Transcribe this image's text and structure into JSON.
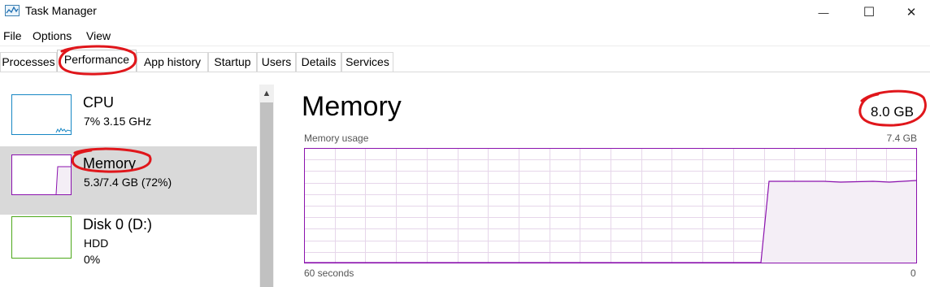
{
  "window": {
    "title": "Task Manager",
    "minimize_glyph": "—",
    "maximize_glyph": "☐",
    "close_glyph": "✕"
  },
  "menu": [
    "File",
    "Options",
    "View"
  ],
  "tabs": [
    "Processes",
    "Performance",
    "App history",
    "Startup",
    "Users",
    "Details",
    "Services"
  ],
  "active_tab": "Performance",
  "sidebar": {
    "items": [
      {
        "name": "CPU",
        "line1": "7%  3.15 GHz",
        "line2": "",
        "color": "#1787c4",
        "selected": false
      },
      {
        "name": "Memory",
        "line1": "5.3/7.4 GB (72%)",
        "line2": "",
        "color": "#8b12ae",
        "selected": true
      },
      {
        "name": "Disk 0 (D:)",
        "line1": "HDD",
        "line2": "0%",
        "color": "#4da81a",
        "selected": false
      }
    ]
  },
  "main": {
    "title": "Memory",
    "total": "8.0 GB",
    "usage_label": "Memory usage",
    "usage_max": "7.4 GB",
    "time_label": "60 seconds",
    "time_zero": "0",
    "accent": "#8b12ae",
    "fill": "#f4eef6"
  },
  "annotation_color": "#e0161b"
}
